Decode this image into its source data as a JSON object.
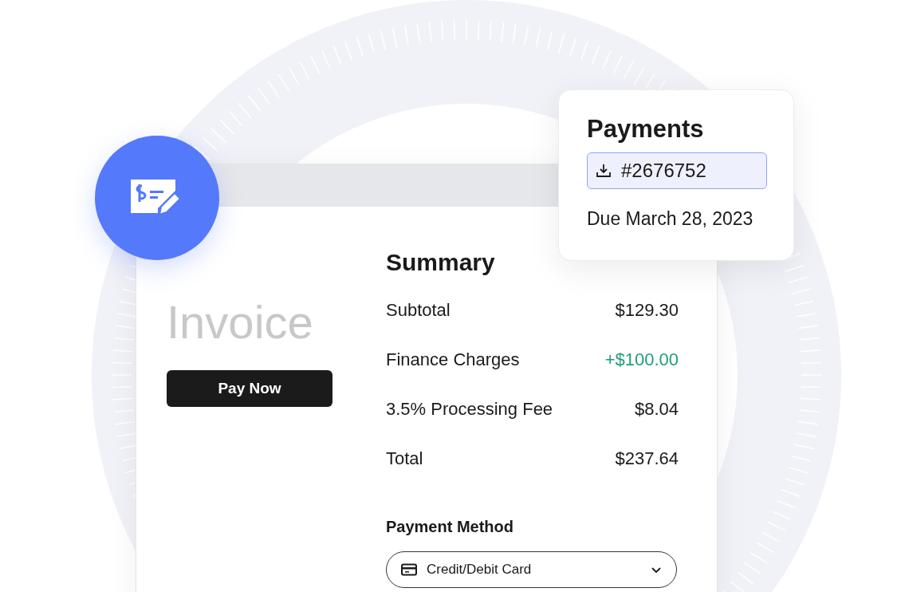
{
  "invoice": {
    "title": "Invoice",
    "pay_button": "Pay Now"
  },
  "summary": {
    "title": "Summary",
    "rows": [
      {
        "label": "Subtotal",
        "value": "$129.30",
        "color": "#1a1a1a"
      },
      {
        "label": "Finance Charges",
        "value": "+$100.00",
        "color": "#1f9e78"
      },
      {
        "label": "3.5% Processing Fee",
        "value": "$8.04",
        "color": "#1a1a1a"
      },
      {
        "label": "Total",
        "value": "$237.64",
        "color": "#1a1a1a"
      }
    ]
  },
  "payment_method": {
    "title": "Payment Method",
    "value": "Credit/Debit Card"
  },
  "payments_popup": {
    "title": "Payments",
    "reference": "#2676752",
    "due": "Due March 28, 2023"
  }
}
